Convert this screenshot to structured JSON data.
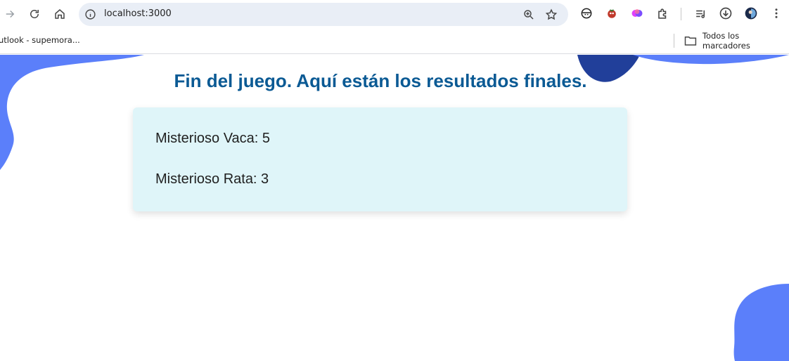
{
  "browser": {
    "url": "localhost:3000",
    "bookmarks": [
      {
        "label": "utlook - supemora..."
      }
    ],
    "all_bookmarks_label": "Todos los marcadores"
  },
  "page": {
    "heading": "Fin del juego. Aquí están los resultados finales.",
    "results": [
      {
        "text": "Misterioso Vaca: 5"
      },
      {
        "text": "Misterioso Rata: 3"
      }
    ]
  },
  "colors": {
    "heading": "#0b5a94",
    "card_background": "#dff5f9",
    "blob_light": "#5b7ffa",
    "blob_dark": "#213f9a"
  }
}
